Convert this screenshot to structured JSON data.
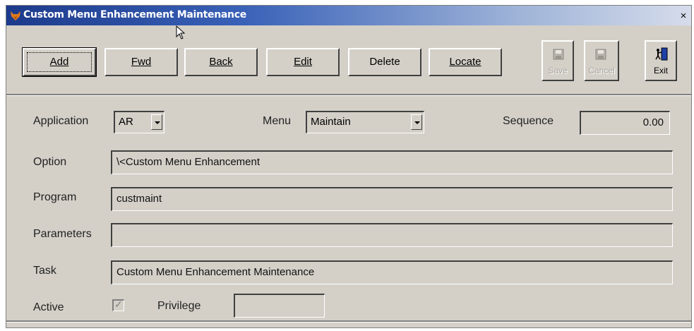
{
  "window": {
    "title": "Custom Menu Enhancement Maintenance",
    "close_glyph": "×"
  },
  "toolbar": {
    "add_label": "Add",
    "fwd_label": "Fwd",
    "back_label": "Back",
    "edit_label": "Edit",
    "delete_label": "Delete",
    "locate_label": "Locate",
    "save_label": "Save",
    "cancel_label": "Cancel",
    "exit_label": "Exit"
  },
  "form": {
    "application_label": "Application",
    "application_value": "AR",
    "menu_label": "Menu",
    "menu_value": "Maintain",
    "sequence_label": "Sequence",
    "sequence_value": "0.00",
    "option_label": "Option",
    "option_value": "\\<Custom Menu Enhancement",
    "program_label": "Program",
    "program_value": "custmaint",
    "parameters_label": "Parameters",
    "parameters_value": "",
    "task_label": "Task",
    "task_value": "Custom Menu Enhancement Maintenance",
    "active_label": "Active",
    "active_checked": true,
    "privilege_label": "Privilege",
    "privilege_value": ""
  },
  "icons": {
    "app": "fox-app-icon",
    "save": "floppy-disk-icon",
    "cancel": "cancel-disk-icon",
    "exit": "exit-door-icon",
    "cursor": "mouse-pointer-icon"
  }
}
